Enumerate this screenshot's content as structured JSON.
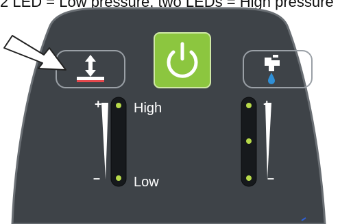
{
  "caption": "2 LED = Low pressure, two LEDs = High pressure",
  "buttons": {
    "pressure_mode": {
      "icon": "pressure-icon"
    },
    "power": {
      "icon": "power-icon",
      "color": "#8cc63f"
    },
    "water": {
      "icon": "faucet-icon"
    }
  },
  "left_indicator": {
    "high_label": "High",
    "low_label": "Low",
    "plus_symbol": "+",
    "minus_symbol": "–",
    "led_color": "#b7d94a"
  },
  "right_indicator": {
    "plus_symbol": "+",
    "minus_symbol": "–",
    "led_color": "#b7d94a"
  },
  "colors": {
    "panel": "#3e4348",
    "panel_edge": "#6a6f74",
    "accent_green": "#8cc63f",
    "water_drop": "#2f8fd6"
  }
}
